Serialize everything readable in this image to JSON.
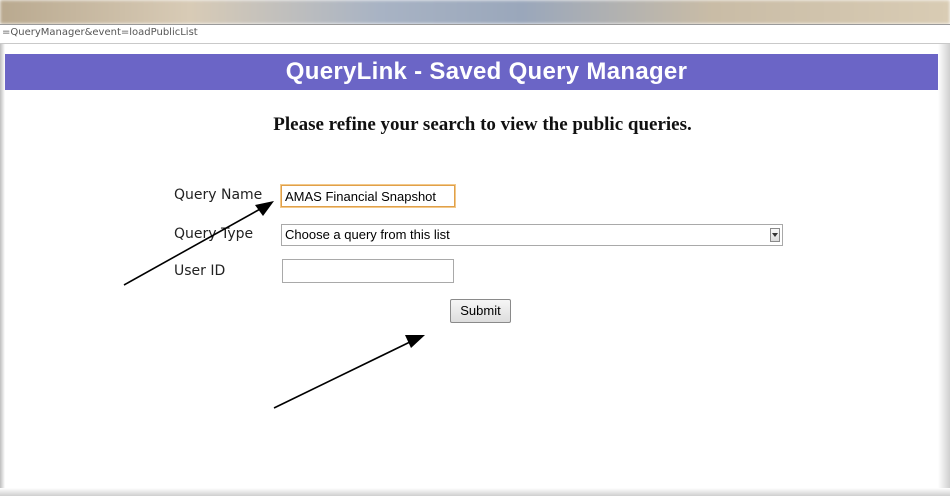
{
  "browser": {
    "url": "=QueryManager&event=loadPublicList"
  },
  "header": {
    "title": "QueryLink - Saved Query Manager"
  },
  "main": {
    "instruction": "Please refine your search to view the public queries."
  },
  "form": {
    "query_name": {
      "label": "Query Name",
      "value": "AMAS Financial Snapshot"
    },
    "query_type": {
      "label": "Query Type",
      "selected": "Choose a query from this list"
    },
    "user_id": {
      "label": "User ID",
      "value": ""
    },
    "submit_label": "Submit"
  },
  "annotations": {
    "arrow_color": "#000000"
  }
}
